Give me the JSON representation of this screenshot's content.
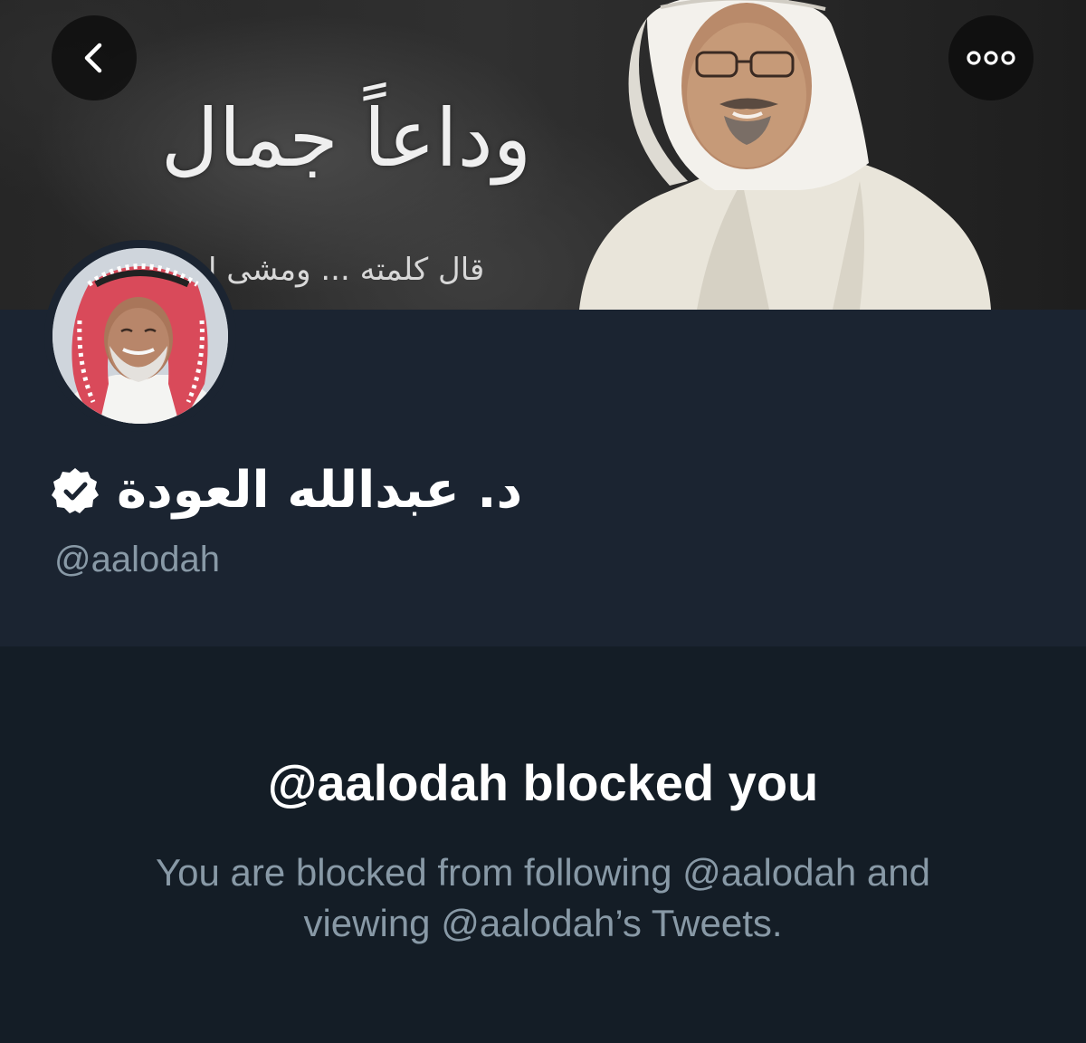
{
  "header": {
    "back_icon": "chevron-left-icon",
    "more_icon": "more-horizontal-icon"
  },
  "banner": {
    "title": "وداعاً جمال",
    "subtitle": "قال كلمته ... ومشى ا"
  },
  "profile": {
    "display_name": "د. عبدالله العودة",
    "verified_icon": "verified-badge-icon",
    "handle": "@aalodah"
  },
  "blocked": {
    "title": "@aalodah blocked you",
    "message": "You are blocked from following @aalodah and viewing @aalodah’s Tweets."
  },
  "colors": {
    "background": "#141d26",
    "profile_background": "#1b2431",
    "primary_text": "#ffffff",
    "secondary_text": "#8899a6"
  }
}
